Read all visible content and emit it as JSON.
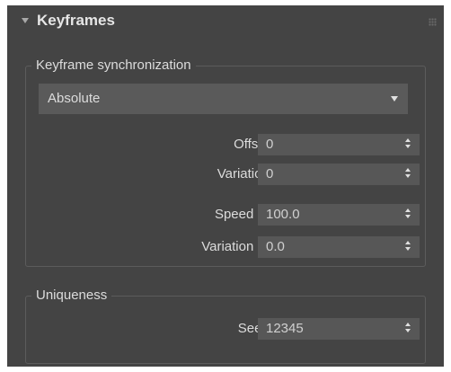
{
  "rollout": {
    "title": "Keyframes"
  },
  "keyframe_sync": {
    "legend": "Keyframe synchronization",
    "mode": "Absolute",
    "fields": [
      {
        "label": "Offset:",
        "value": "0"
      },
      {
        "label": "Variation:",
        "value": "0"
      },
      {
        "label": "Speed %:",
        "value": "100.0"
      },
      {
        "label": "Variation %:",
        "value": "0.0"
      }
    ]
  },
  "uniqueness": {
    "legend": "Uniqueness",
    "seed": {
      "label": "Seed:",
      "value": "12345"
    }
  },
  "icons": {
    "collapse": "triangle-down-icon",
    "grip": "drag-grip-icon",
    "dropdown": "chevron-down-icon",
    "spinner": "up-down-arrows-icon"
  },
  "colors": {
    "panel_bg": "#444444",
    "field_bg": "#575757",
    "dropdown_bg": "#5a5a5a",
    "text": "#dcdcdc"
  }
}
